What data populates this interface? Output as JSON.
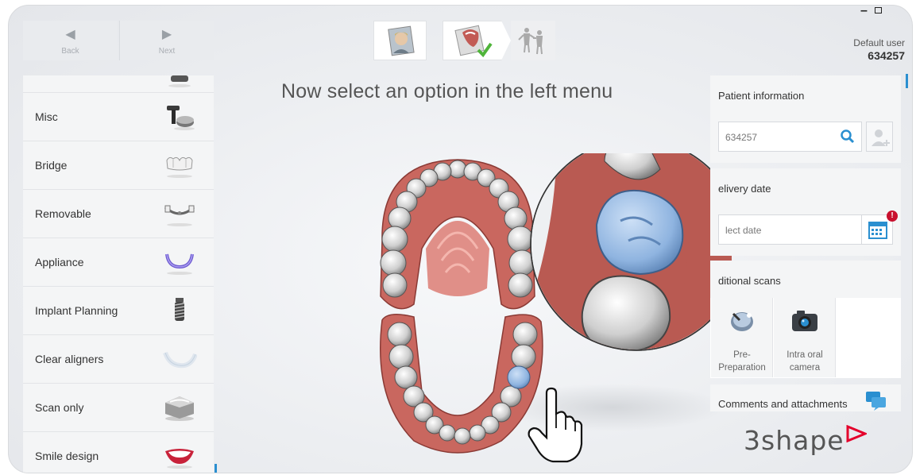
{
  "nav": {
    "back_label": "Back",
    "next_label": "Next"
  },
  "user": {
    "name": "Default user",
    "id": "634257"
  },
  "headline": "Now select an option in the left menu",
  "menu_items": [
    {
      "label": "Misc",
      "icon": "abutment-icon"
    },
    {
      "label": "Bridge",
      "icon": "bridge-icon"
    },
    {
      "label": "Removable",
      "icon": "removable-icon"
    },
    {
      "label": "Appliance",
      "icon": "appliance-icon"
    },
    {
      "label": "Implant Planning",
      "icon": "implant-icon"
    },
    {
      "label": "Clear aligners",
      "icon": "aligner-icon"
    },
    {
      "label": "Scan only",
      "icon": "scan-model-icon"
    },
    {
      "label": "Smile design",
      "icon": "smile-icon"
    }
  ],
  "patient": {
    "title": "Patient information",
    "value": "634257"
  },
  "delivery": {
    "title": "elivery date",
    "placeholder": "lect date",
    "badge": "!"
  },
  "scans": {
    "title": "ditional scans",
    "tiles": [
      {
        "line1": "Pre-",
        "line2": "Preparation",
        "icon": "pre-preparation-icon"
      },
      {
        "line1": "Intra oral",
        "line2": "camera",
        "icon": "camera-icon"
      }
    ]
  },
  "comments": {
    "title": "Comments and attachments"
  },
  "logo": "3shape",
  "colors": {
    "accent": "#2a8fd0",
    "gum": "#cf6f66",
    "selected_tooth": "#8fb4e0",
    "badge": "#c8102e"
  }
}
